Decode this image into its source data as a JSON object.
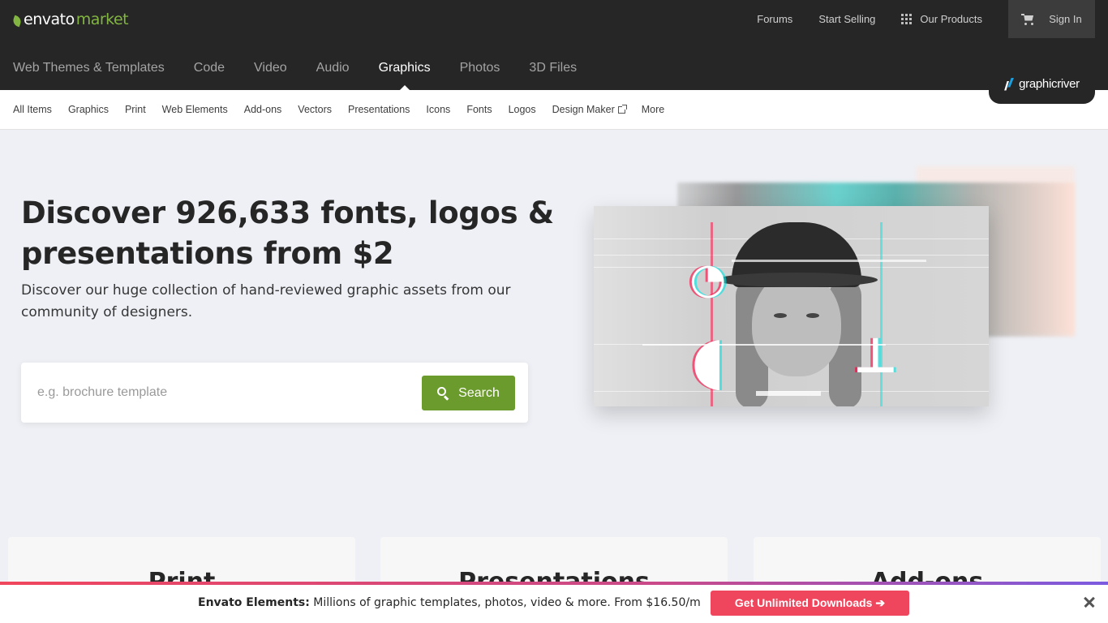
{
  "header": {
    "logo": {
      "brand": "envato",
      "suffix": "market"
    },
    "links": [
      {
        "label": "Forums"
      },
      {
        "label": "Start Selling"
      },
      {
        "label": "Our Products"
      }
    ],
    "signin_label": "Sign In",
    "icons": {
      "products": "grid-icon",
      "cart": "cart-icon"
    }
  },
  "categories": [
    {
      "label": "Web Themes & Templates"
    },
    {
      "label": "Code"
    },
    {
      "label": "Video"
    },
    {
      "label": "Audio"
    },
    {
      "label": "Graphics",
      "active": true
    },
    {
      "label": "Photos"
    },
    {
      "label": "3D Files"
    }
  ],
  "brand_badge": {
    "text": "graphicriver"
  },
  "subnav": [
    {
      "label": "All Items"
    },
    {
      "label": "Graphics"
    },
    {
      "label": "Print"
    },
    {
      "label": "Web Elements"
    },
    {
      "label": "Add-ons"
    },
    {
      "label": "Vectors"
    },
    {
      "label": "Presentations"
    },
    {
      "label": "Icons"
    },
    {
      "label": "Fonts"
    },
    {
      "label": "Logos"
    },
    {
      "label": "Design Maker",
      "external": true
    },
    {
      "label": "More"
    }
  ],
  "hero": {
    "title": "Discover 926,633 fonts, logos & presentations from $2",
    "subtitle": "Discover our huge collection of hand-reviewed graphic assets from our community of designers.",
    "search": {
      "placeholder": "e.g. brochure template",
      "value": "",
      "button_label": "Search"
    }
  },
  "cards": [
    {
      "title": "Print"
    },
    {
      "title": "Presentations"
    },
    {
      "title": "Add-ons"
    }
  ],
  "banner": {
    "brand": "Envato Elements:",
    "text": " Millions of graphic templates, photos, video & more. From $16.50/m",
    "button_label": "Get Unlimited Downloads ➔"
  },
  "colors": {
    "topbar": "#262626",
    "accent_green": "#82b541",
    "search_button": "#6c9b2d",
    "banner_button": "#f0465d"
  }
}
